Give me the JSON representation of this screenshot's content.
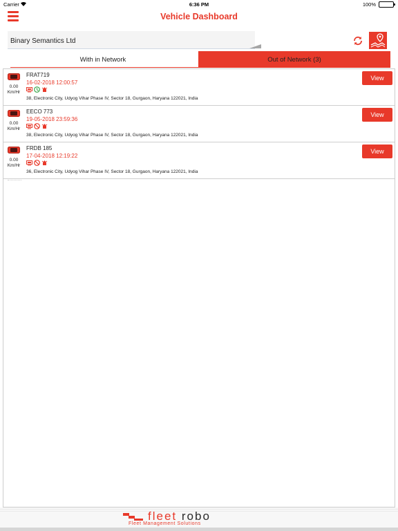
{
  "status_bar": {
    "carrier": "Carrier",
    "time": "6:36 PM",
    "battery": "100%"
  },
  "header": {
    "title": "Vehicle Dashboard",
    "menu_icon": "hamburger-icon"
  },
  "company": {
    "name": "Binary Semantics Ltd",
    "refresh_icon": "refresh-icon",
    "map_icon": "map-pin-icon"
  },
  "tabs": [
    {
      "label": "With in Network",
      "selected": false
    },
    {
      "label": "Out of Network (3)",
      "selected": true
    }
  ],
  "vehicles": [
    {
      "name": "FRAT719",
      "datetime": "16-02-2018 12:00:57",
      "speed": "0.00",
      "speed_unit": "Km/Hr",
      "address": "38, Electronic City, Udyog Vihar Phase IV, Sector 18, Gurgaon, Haryana 122021, India",
      "status_icons": [
        "gps-icon",
        "ignition-on-icon",
        "alert-icon"
      ],
      "view_label": "View"
    },
    {
      "name": "EECO 773",
      "datetime": "19-05-2018 23:59:36",
      "speed": "0.00",
      "speed_unit": "Km/Hr",
      "address": "38, Electronic City, Udyog Vihar Phase IV, Sector 18, Gurgaon, Haryana 122021, India",
      "status_icons": [
        "gps-icon",
        "ignition-off-icon",
        "alert-icon"
      ],
      "view_label": "View"
    },
    {
      "name": "FRDB 185",
      "datetime": "17-04-2018 12:19:22",
      "speed": "0.00",
      "speed_unit": "Km/Hr",
      "address": "36, Electronic City, Udyog Vihar Phase IV, Sector 18, Gurgaon, Haryana 122021, India",
      "status_icons": [
        "gps-icon",
        "ignition-off-icon",
        "alert-icon"
      ],
      "view_label": "View"
    }
  ],
  "footer": {
    "logo_word1": "fleet",
    "logo_word2": "robo",
    "tagline": "Fleet Management Solutions"
  },
  "colors": {
    "accent": "#e8392a",
    "ignition_on": "#3aa54a"
  }
}
